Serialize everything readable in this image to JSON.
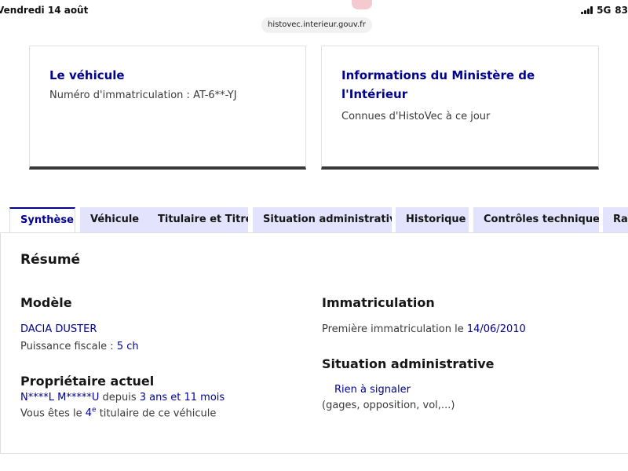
{
  "status_bar": {
    "date": "Vendredi 14 août",
    "network": "5G",
    "battery": "83"
  },
  "browser": {
    "url": "histovec.interieur.gouv.fr"
  },
  "cards": {
    "vehicle": {
      "title": "Le véhicule",
      "text": "Numéro d'immatriculation : AT-6**-YJ"
    },
    "ministry": {
      "title": "Informations du Ministère de l'Intérieur",
      "text": "Connues d'HistoVec à ce jour"
    }
  },
  "tabs": [
    {
      "label": "Synthèse"
    },
    {
      "label": "Véhicule"
    },
    {
      "label": "Titulaire et Titre"
    },
    {
      "label": "Situation administrative"
    },
    {
      "label": "Historique"
    },
    {
      "label": "Contrôles techniques"
    },
    {
      "label": "Rapport"
    }
  ],
  "summary": {
    "title": "Résumé",
    "model": {
      "title": "Modèle",
      "name": "DACIA DUSTER",
      "power_label": "Puissance fiscale : ",
      "power_value": "5 ch"
    },
    "owner": {
      "title": "Propriétaire actuel",
      "name": "N****L M*****U",
      "since_label": " depuis ",
      "since_value": "3 ans et 11 mois",
      "rank_prefix": "Vous êtes le ",
      "rank_number": "4",
      "rank_sup": "e",
      "rank_suffix": " titulaire de ce véhicule"
    },
    "registration": {
      "title": "Immatriculation",
      "first_label": "Première immatriculation le ",
      "first_date": "14/06/2010"
    },
    "admin": {
      "title": "Situation administrative",
      "status": "Rien à signaler",
      "details": "(gages, opposition, vol,...)"
    }
  }
}
